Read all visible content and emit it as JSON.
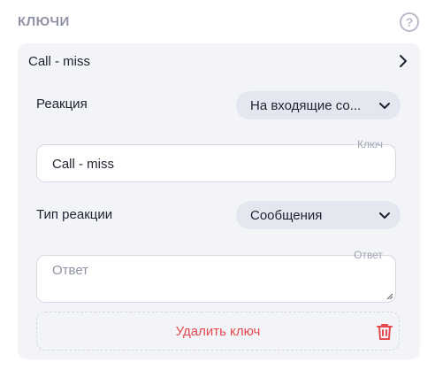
{
  "header": {
    "title": "КЛЮЧИ",
    "help_icon": "?"
  },
  "key_card": {
    "title": "Call - miss",
    "reaction": {
      "label": "Реакция",
      "value": "На входящие со..."
    },
    "key_field": {
      "label": "Ключ",
      "value": "Call - miss"
    },
    "reaction_type": {
      "label": "Тип реакции",
      "value": "Сообщения"
    },
    "answer_field": {
      "label": "Ответ",
      "placeholder": "Ответ"
    },
    "delete": {
      "label": "Удалить ключ"
    }
  },
  "colors": {
    "danger": "#e5484d",
    "card_bg": "#f3f4f8",
    "select_bg": "#e4e7ef",
    "title_gray": "#8f93a3"
  }
}
